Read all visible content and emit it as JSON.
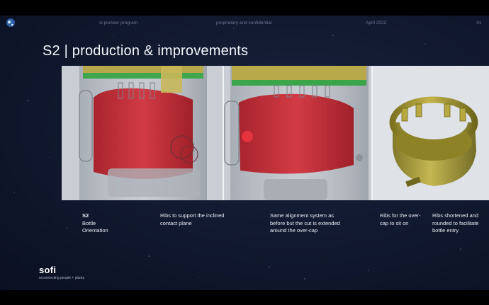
{
  "header": {
    "program": "sl pioneer program",
    "confidential": "proprietary and confidential",
    "date": "April 2022",
    "page_number": "41"
  },
  "slide": {
    "title": "S2 | production & improvements"
  },
  "captions": {
    "c1": {
      "line1": "S2",
      "line2": "Bottle",
      "line3": "Orientation"
    },
    "c2": "Ribs to support the inclined contact plane",
    "c3": "Same alignment system as before but the cut is extended around the over-cap",
    "c4": "Ribs for the over-cap to sit on",
    "c5": "Ribs shortened and rounded to facilitate bottle entry"
  },
  "logo": {
    "brand": "sofi",
    "tagline": "reconnecting people + plants"
  },
  "colors": {
    "background": "#121a30",
    "part_red": "#c8333d",
    "part_olive": "#a89b2e",
    "part_green": "#3aa64a"
  }
}
